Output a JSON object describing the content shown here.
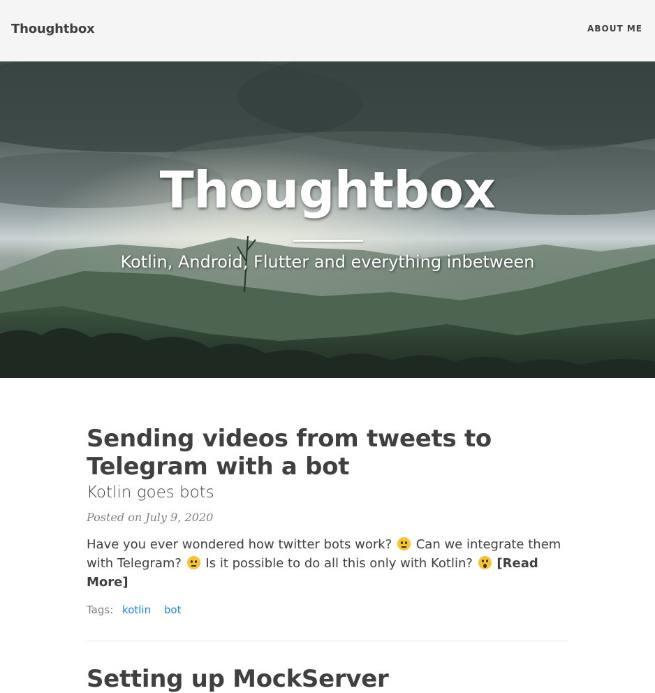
{
  "navbar": {
    "brand": "Thoughtbox",
    "about_label": "ABOUT ME"
  },
  "hero": {
    "title": "Thoughtbox",
    "subtitle": "Kotlin, Android, Flutter and everything inbetween"
  },
  "posts": [
    {
      "title": "Sending videos from tweets to Telegram with a bot",
      "subtitle": "Kotlin goes bots",
      "meta": "Posted on July 9, 2020",
      "excerpt_part1": "Have you ever wondered how twitter bots work?",
      "excerpt_part2": "Can we integrate them with Telegram?",
      "excerpt_part3": "Is it possible to do all this only with Kotlin?",
      "emoji1": "thinking-face",
      "emoji2": "thinking-face",
      "emoji3": "astonished-face",
      "read_more": "[Read More]",
      "tags_label": "Tags:",
      "tags": [
        "kotlin",
        "bot"
      ]
    },
    {
      "title": "Setting up MockServer"
    }
  ],
  "colors": {
    "navbar_bg": "#f5f5f5",
    "text": "#404040",
    "meta": "#808080",
    "tag_link": "#1e88d8"
  }
}
